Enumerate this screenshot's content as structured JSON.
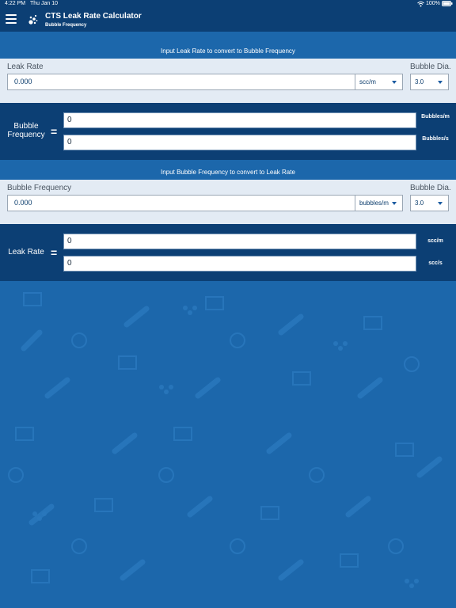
{
  "status_bar": {
    "time": "4:22 PM",
    "date": "Thu Jan 10",
    "battery": "100%"
  },
  "header": {
    "title": "CTS Leak Rate Calculator",
    "subtitle": "Bubble Frequency"
  },
  "section1": {
    "instruction": "Input Leak Rate to convert to Bubble Frequency",
    "input_label": "Leak Rate",
    "input_value": "0.000",
    "unit_value": "scc/m",
    "dia_label": "Bubble Dia.",
    "dia_value": "3.0",
    "result_label": "Bubble Frequency",
    "equals": "=",
    "results": [
      {
        "value": "0",
        "unit": "Bubbles/m"
      },
      {
        "value": "0",
        "unit": "Bubbles/s"
      }
    ]
  },
  "section2": {
    "instruction": "Input Bubble Frequency to convert to Leak Rate",
    "input_label": "Bubble Frequency",
    "input_value": "0.000",
    "unit_value": "bubbles/m",
    "dia_label": "Bubble Dia.",
    "dia_value": "3.0",
    "result_label": "Leak Rate",
    "equals": "=",
    "results": [
      {
        "value": "0",
        "unit": "scc/m"
      },
      {
        "value": "0",
        "unit": "scc/s"
      }
    ]
  },
  "colors": {
    "header_bg": "#0c3f74",
    "background": "#1c67ab",
    "panel_bg": "#e3ebf4",
    "accent": "#1a5aa0"
  }
}
